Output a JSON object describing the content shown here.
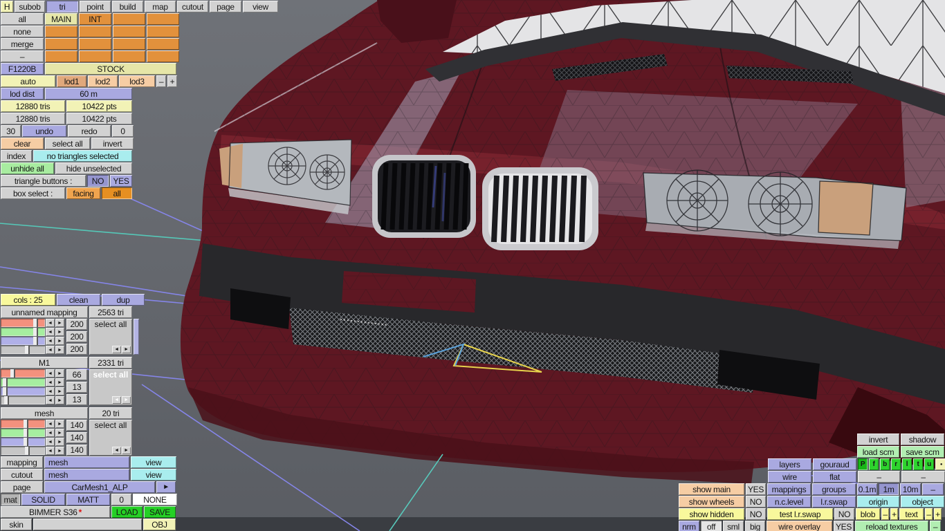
{
  "toolbar": {
    "items": [
      "H",
      "subob",
      "tri",
      "point",
      "build",
      "map",
      "cutout",
      "page",
      "view"
    ]
  },
  "subobject": {
    "side_buttons": [
      "all",
      "none",
      "merge",
      "–"
    ],
    "cells": [
      "MAIN",
      "INT"
    ]
  },
  "lod": {
    "code": "F1220B",
    "stock": "STOCK",
    "auto": "auto",
    "lod1": "lod1",
    "lod2": "lod2",
    "lod3": "lod3",
    "minus": "–",
    "plus": "+",
    "dist_label": "lod dist",
    "dist_value": "60 m"
  },
  "stats": {
    "tris_a": "12880 tris",
    "pts_a": "10422 pts",
    "tris_b": "12880 tris",
    "pts_b": "10422 pts",
    "undo_count": "30",
    "undo": "undo",
    "redo": "redo",
    "redo_count": "0"
  },
  "selection": {
    "clear": "clear",
    "select_all": "select all",
    "invert": "invert",
    "index": "index",
    "status": "no triangles selected",
    "unhide_all": "unhide all",
    "hide_unselected": "hide unselected",
    "triangle_buttons_label": "triangle buttons :",
    "no": "NO",
    "yes": "YES",
    "box_select_label": "box select :",
    "facing": "facing",
    "all": "all"
  },
  "colors_panel": {
    "cols_header": "cols : 25",
    "clean": "clean",
    "dup": "dup",
    "mappings": [
      {
        "name": "unnamed mapping",
        "count": "2563 tri",
        "r": "200",
        "g": "200",
        "b": "200",
        "select": "select all"
      },
      {
        "name": "M1",
        "count": "2331 tri",
        "r": "66",
        "g": "13",
        "b": "13",
        "select": "select all"
      },
      {
        "name": "mesh",
        "count": "20 tri",
        "r": "140",
        "g": "140",
        "b": "140",
        "select": "select all"
      }
    ]
  },
  "object_panel": {
    "mapping_label": "mapping",
    "mapping_value": "mesh",
    "view": "view",
    "cutout_label": "cutout",
    "cutout_value": "mesh",
    "view2": "view",
    "page_label": "page",
    "page_value": "CarMesh1_ALP",
    "next_arrow": "►",
    "mat_label": "mat",
    "solid": "SOLID",
    "matt": "MATT",
    "mat_num": "0",
    "mat_none": "NONE",
    "model_name": "BIMMER S36",
    "model_star": "*",
    "load": "LOAD",
    "save": "SAVE",
    "skin_label": "skin",
    "obj": "OBJ"
  },
  "view_panel": {
    "invert": "invert",
    "shadow": "shadow",
    "load_scm": "load scm",
    "save_scm": "save scm",
    "layers": "layers",
    "gouraud": "gouraud",
    "views": [
      "P",
      "f",
      "b",
      "r",
      "l",
      "t",
      "u"
    ],
    "dot": "●",
    "wire": "wire",
    "flat": "flat",
    "dash": "–",
    "show_main": "show main",
    "yes": "YES",
    "mappings": "mappings",
    "groups": "groups",
    "grid_01m": "0.1m",
    "grid_1m": "1m",
    "grid_10m": "10m",
    "show_wheels": "show wheels",
    "no": "NO",
    "nc_level": "n.c.level",
    "lr_swap": "l.r.swap",
    "origin": "origin",
    "object": "object",
    "show_hidden": "show hidden",
    "test_lr_swap": "test l.r.swap",
    "blob": "blob",
    "text": "text",
    "minus": "–",
    "plus": "+",
    "nrm": "nrm",
    "off": "off",
    "sml": "sml",
    "big": "big",
    "wire_overlay": "wire overlay",
    "reload_textures": "reload textures"
  },
  "icons": {
    "left": "◄",
    "right": "►"
  },
  "viewport": {
    "background": "#65686f",
    "bottom_strip": "#3a3d42",
    "car_body_color": "#5e1722",
    "selected_triangle_color": "#e8d44c",
    "selected_edge_color": "#5aa0d8",
    "grid_line_teal": "#55c8b8",
    "grid_line_lavender": "#8585e8"
  }
}
